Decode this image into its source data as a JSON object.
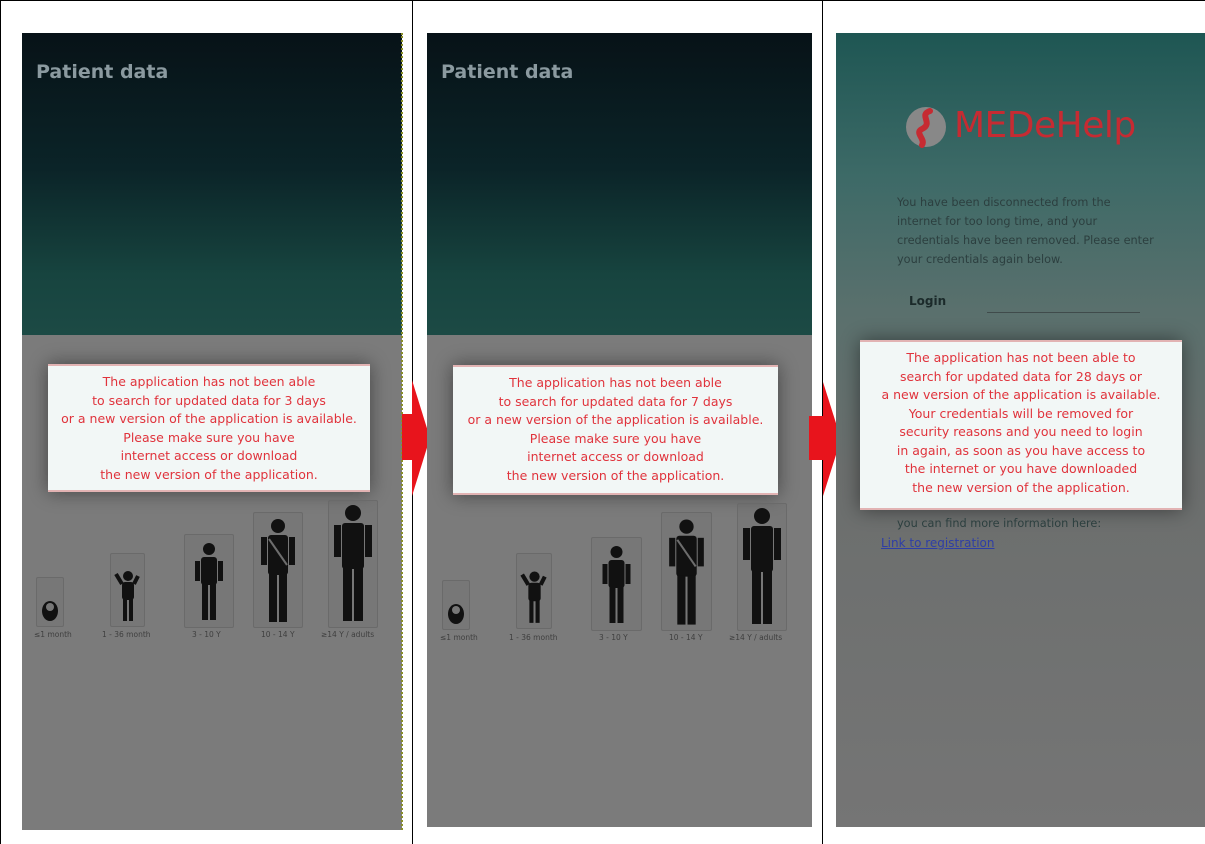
{
  "screens": [
    {
      "title": "Patient data",
      "popup_lines": [
        "The application has not been able",
        "to search for updated data for 3 days",
        "or a new version of the application is available.",
        "Please make sure you have",
        "internet access or download",
        "the new version of the application."
      ],
      "age_groups": [
        "≤1 month",
        "1 - 36 month",
        "3 - 10 Y",
        "10 - 14 Y",
        "≥14 Y / adults"
      ]
    },
    {
      "title": "Patient data",
      "popup_lines": [
        "The application has not been able",
        "to search for updated data for 7 days",
        "or a new version of the application is available.",
        "Please make sure you have",
        "internet access or download",
        "the new version of the application."
      ],
      "age_groups": [
        "≤1 month",
        "1 - 36 month",
        "3 - 10 Y",
        "10 - 14 Y",
        "≥14 Y / adults"
      ]
    },
    {
      "logo_text": "MEDeHelp",
      "info_text": "You have been disconnected from the internet for too long time, and your credentials have been removed. Please enter your credentials again below.",
      "login_label": "Login",
      "popup_lines": [
        "The application has not been able to",
        "search for updated data for 28 days or",
        "a new version of the application is available.",
        "Your credentials will be removed for",
        "security reasons and you need to login",
        "in again, as soon as you have access to",
        "the internet or you have downloaded",
        "the new version of the application."
      ],
      "more_info_text": "you can find more information here:",
      "registration_link": "Link to registration"
    }
  ],
  "colors": {
    "popup_text": "#e0333c",
    "arrow": "#e8141c",
    "logo": "#c62b32"
  }
}
